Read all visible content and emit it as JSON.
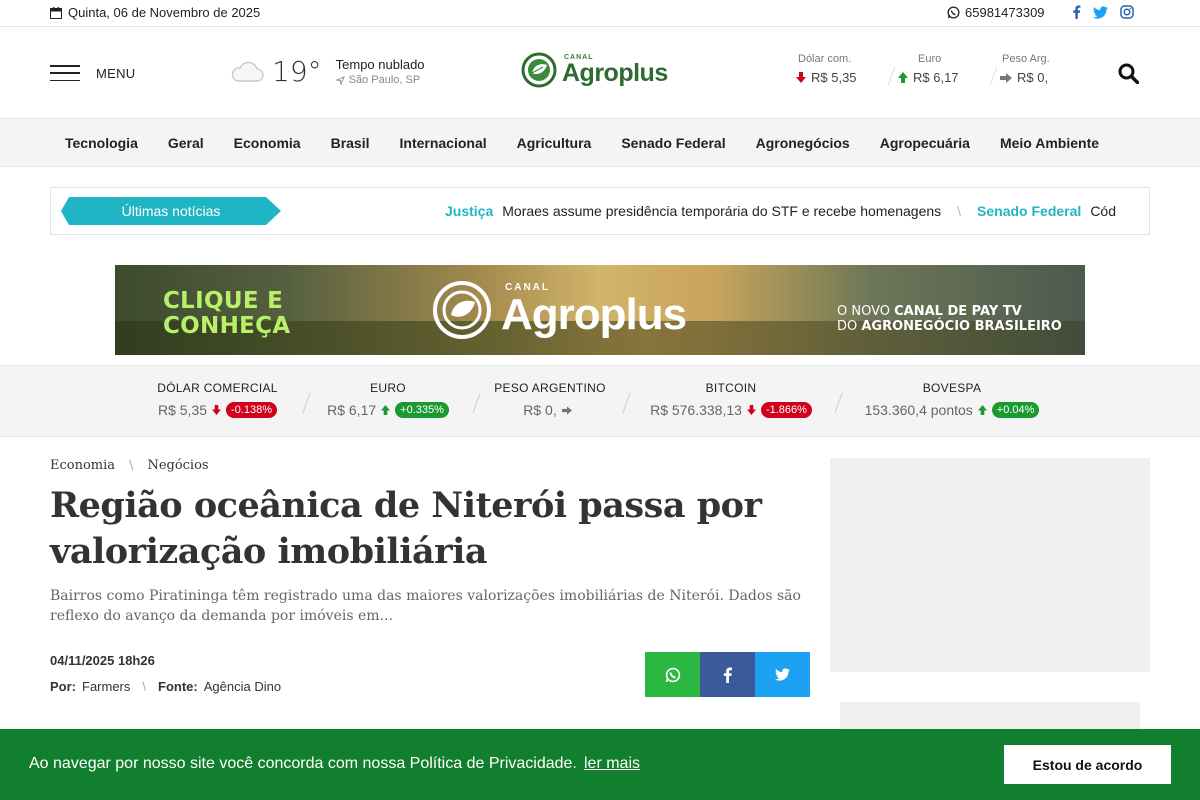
{
  "topbar": {
    "date": "Quinta, 06 de Novembro de 2025",
    "phone": "65981473309",
    "social_icons": [
      "facebook-icon",
      "twitter-icon",
      "instagram-icon"
    ]
  },
  "header": {
    "menu_label": "MENU",
    "weather": {
      "temp": "19°",
      "condition": "Tempo nublado",
      "location": "São Paulo, SP"
    },
    "logo": {
      "canal": "CANAL",
      "brand": "Agroplus"
    },
    "quotes": [
      {
        "label": "Dólar com.",
        "value": "R$ 5,35",
        "trend": "down"
      },
      {
        "label": "Euro",
        "value": "R$ 6,17",
        "trend": "up"
      },
      {
        "label": "Peso Arg.",
        "value": "R$ 0,",
        "trend": "flat"
      }
    ]
  },
  "nav": {
    "items": [
      "Tecnologia",
      "Geral",
      "Economia",
      "Brasil",
      "Internacional",
      "Agricultura",
      "Senado Federal",
      "Agronegócios",
      "Agropecuária",
      "Meio Ambiente"
    ]
  },
  "ticker": {
    "label": "Últimas notícias",
    "items": [
      {
        "category": "Justiça",
        "text": "Moraes assume presidência temporária do STF e recebe homenagens"
      },
      {
        "category": "Senado Federal",
        "text": "Cód"
      }
    ]
  },
  "banner": {
    "cta_line1": "CLIQUE E",
    "cta_line2": "CONHEÇA",
    "canal": "CANAL",
    "brand": "Agroplus",
    "tag_line1_prefix": "O NOVO ",
    "tag_line1_bold": "CANAL DE PAY TV",
    "tag_line2_prefix": "DO ",
    "tag_line2_bold": "AGRONEGÓCIO BRASILEIRO"
  },
  "quote_strip": [
    {
      "name": "DÓLAR COMERCIAL",
      "value": "R$ 5,35",
      "trend": "down",
      "change": "-0.138%"
    },
    {
      "name": "EURO",
      "value": "R$ 6,17",
      "trend": "up",
      "change": "+0.335%"
    },
    {
      "name": "PESO ARGENTINO",
      "value": "R$ 0,",
      "trend": "flat",
      "change": ""
    },
    {
      "name": "BITCOIN",
      "value": "R$ 576.338,13",
      "trend": "down",
      "change": "-1.866%"
    },
    {
      "name": "BOVESPA",
      "value": "153.360,4 pontos",
      "trend": "up",
      "change": "+0.04%"
    }
  ],
  "article": {
    "breadcrumb": [
      "Economia",
      "Negócios"
    ],
    "title": "Região oceânica de Niterói passa por valorização imobiliária",
    "lead": "Bairros como Piratininga têm registrado uma das maiores valorizações imobiliárias de Niterói. Dados são reflexo do avanço da demanda por imóveis em...",
    "date": "04/11/2025 18h26",
    "by_label": "Por:",
    "author": "Farmers",
    "source_label": "Fonte:",
    "source": "Agência Dino"
  },
  "cookie": {
    "text": "Ao navegar por nosso site você concorda com nossa Política de Privacidade.",
    "link": "ler mais",
    "button": "Estou de acordo"
  },
  "colors": {
    "accent": "#1fb5c4",
    "brand_green": "#2f6b2f",
    "cookie_bg": "#127f2e",
    "negative": "#d0021b",
    "positive": "#1a9b32"
  }
}
